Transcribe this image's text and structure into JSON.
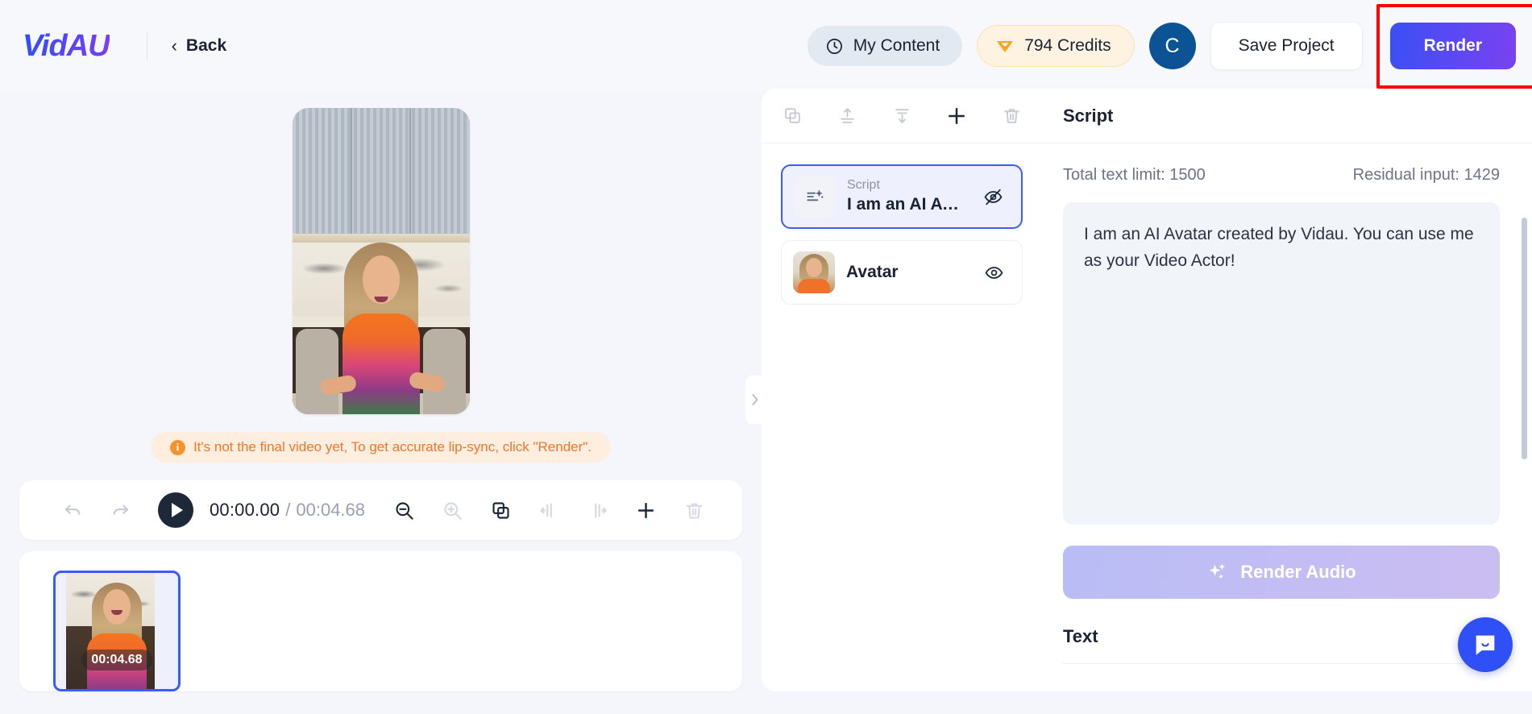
{
  "header": {
    "logo": "VidAU",
    "back_label": "Back",
    "back_icon": "chevron-left-icon",
    "my_content_label": "My Content",
    "my_content_icon": "clock-icon",
    "credits_label": "794 Credits",
    "credits_icon": "gem-icon",
    "avatar_initial": "C",
    "avatar_color": "#0b5394",
    "save_label": "Save Project",
    "render_label": "Render",
    "render_gradient_from": "#3b4ff5",
    "render_gradient_to": "#7a42f0",
    "annotation_color": "#ff0000"
  },
  "preview": {
    "warning_text": "It's not the final video yet, To get accurate lip-sync, click \"Render\".",
    "warning_icon": "info-icon",
    "warning_color": "#f4762a"
  },
  "timeline": {
    "undo_icon": "undo-icon",
    "redo_icon": "redo-icon",
    "play_icon": "play-icon",
    "current_time": "00:00.00",
    "separator": "/",
    "total_time": "00:04.68",
    "tools": [
      {
        "name": "zoom-out-icon",
        "enabled": true
      },
      {
        "name": "zoom-in-icon",
        "enabled": false
      },
      {
        "name": "duplicate-icon",
        "enabled": true
      },
      {
        "name": "split-left-icon",
        "enabled": false
      },
      {
        "name": "split-right-icon",
        "enabled": false
      },
      {
        "name": "add-icon",
        "enabled": true
      },
      {
        "name": "delete-icon",
        "enabled": false
      }
    ],
    "clip_duration": "00:04.68"
  },
  "layers": {
    "toolbar": [
      {
        "name": "copy-icon",
        "enabled": false
      },
      {
        "name": "move-up-icon",
        "enabled": false
      },
      {
        "name": "move-down-icon",
        "enabled": false
      },
      {
        "name": "add-layer-icon",
        "enabled": true
      },
      {
        "name": "delete-layer-icon",
        "enabled": false
      }
    ],
    "items": [
      {
        "type": "script",
        "sub_label": "Script",
        "title": "I am an AI Ava…",
        "visibility_icon": "eye-off-icon",
        "selected": true
      },
      {
        "type": "avatar",
        "title": "Avatar",
        "visibility_icon": "eye-icon",
        "selected": false
      }
    ],
    "collapse_icon": "chevron-right-icon"
  },
  "right_panel": {
    "title": "Script",
    "total_limit_label": "Total text limit: 1500",
    "residual_label": "Residual input: 1429",
    "script_text": "I am an AI Avatar created by Vidau. You can use me as your Video Actor!",
    "render_audio_label": "Render Audio",
    "render_audio_icon": "sparkle-icon",
    "text_section_title": "Text",
    "chat_icon": "chat-bubble-icon"
  }
}
